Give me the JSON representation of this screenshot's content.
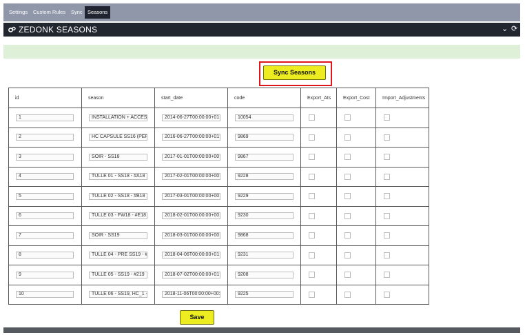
{
  "nav": {
    "tabs": [
      {
        "label": "Settings",
        "active": false
      },
      {
        "label": "Custom Rules",
        "active": false
      },
      {
        "label": "Sync",
        "active": false
      },
      {
        "label": "Seasons",
        "active": true
      }
    ]
  },
  "header": {
    "title": "ZEDONK SEASONS",
    "icons": [
      "gear-logo-icon",
      "chevron-down-icon",
      "refresh-icon"
    ],
    "collapse_glyph": "⌄",
    "refresh_glyph": "⟳"
  },
  "sync_button": {
    "label": "Sync Seasons"
  },
  "save_button": {
    "label": "Save"
  },
  "table": {
    "columns": [
      "id",
      "season",
      "start_date",
      "code",
      "Export_Ats",
      "Export_Cost",
      "Import_Adjustments"
    ],
    "rows": [
      {
        "id": "1",
        "season": "INSTALLATION + ACCESS(",
        "start_date": "2014-06-27T00:00:00+01:0(",
        "code": "10054",
        "export_ats": false,
        "export_cost": false,
        "import_adjustments": false
      },
      {
        "id": "2",
        "season": "HC CAPSULE SS16 (PERF",
        "start_date": "2016-06-27T00:00:00+01:0(",
        "code": "9869",
        "export_ats": false,
        "export_cost": false,
        "import_adjustments": false
      },
      {
        "id": "3",
        "season": "SOIR - SS18",
        "start_date": "2017-01-01T00:00:00+00:0(",
        "code": "9867",
        "export_ats": false,
        "export_cost": false,
        "import_adjustments": false
      },
      {
        "id": "4",
        "season": "TULLE 01 - SS18 - #A18",
        "start_date": "2017-02-01T00:00:00+00:0(",
        "code": "9228",
        "export_ats": false,
        "export_cost": false,
        "import_adjustments": false
      },
      {
        "id": "5",
        "season": "TULLE 02 - SS18 - #B18",
        "start_date": "2017-03-01T00:00:00+00:0(",
        "code": "9229",
        "export_ats": false,
        "export_cost": false,
        "import_adjustments": false
      },
      {
        "id": "6",
        "season": "TULLE 03 - FW18 - #E18",
        "start_date": "2018-02-01T00:00:00+00:0(",
        "code": "9230",
        "export_ats": false,
        "export_cost": false,
        "import_adjustments": false
      },
      {
        "id": "7",
        "season": "SOIR - SS19",
        "start_date": "2018-03-01T00:00:00+00:0(",
        "code": "9868",
        "export_ats": false,
        "export_cost": false,
        "import_adjustments": false
      },
      {
        "id": "8",
        "season": "TULLE 04 - PRE SS19 - #1'",
        "start_date": "2018-04-06T00:00:00+01:0(",
        "code": "9231",
        "export_ats": false,
        "export_cost": false,
        "import_adjustments": false
      },
      {
        "id": "9",
        "season": "TULLE 05 - SS19 - #219",
        "start_date": "2018-07-02T00:00:00+01:0(",
        "code": "9208",
        "export_ats": false,
        "export_cost": false,
        "import_adjustments": false
      },
      {
        "id": "10",
        "season": "TULLE 06 - SS19, HC_1 - #",
        "start_date": "2018-11-06T00:00:00+00:0(",
        "code": "9225",
        "export_ats": false,
        "export_cost": false,
        "import_adjustments": false
      }
    ]
  },
  "colors": {
    "nav_bg": "#8f97a8",
    "titlebar_bg": "#22262f",
    "notice_bg": "#dff0d8",
    "button_bg": "#ecec20",
    "highlight": "#e0141b"
  }
}
